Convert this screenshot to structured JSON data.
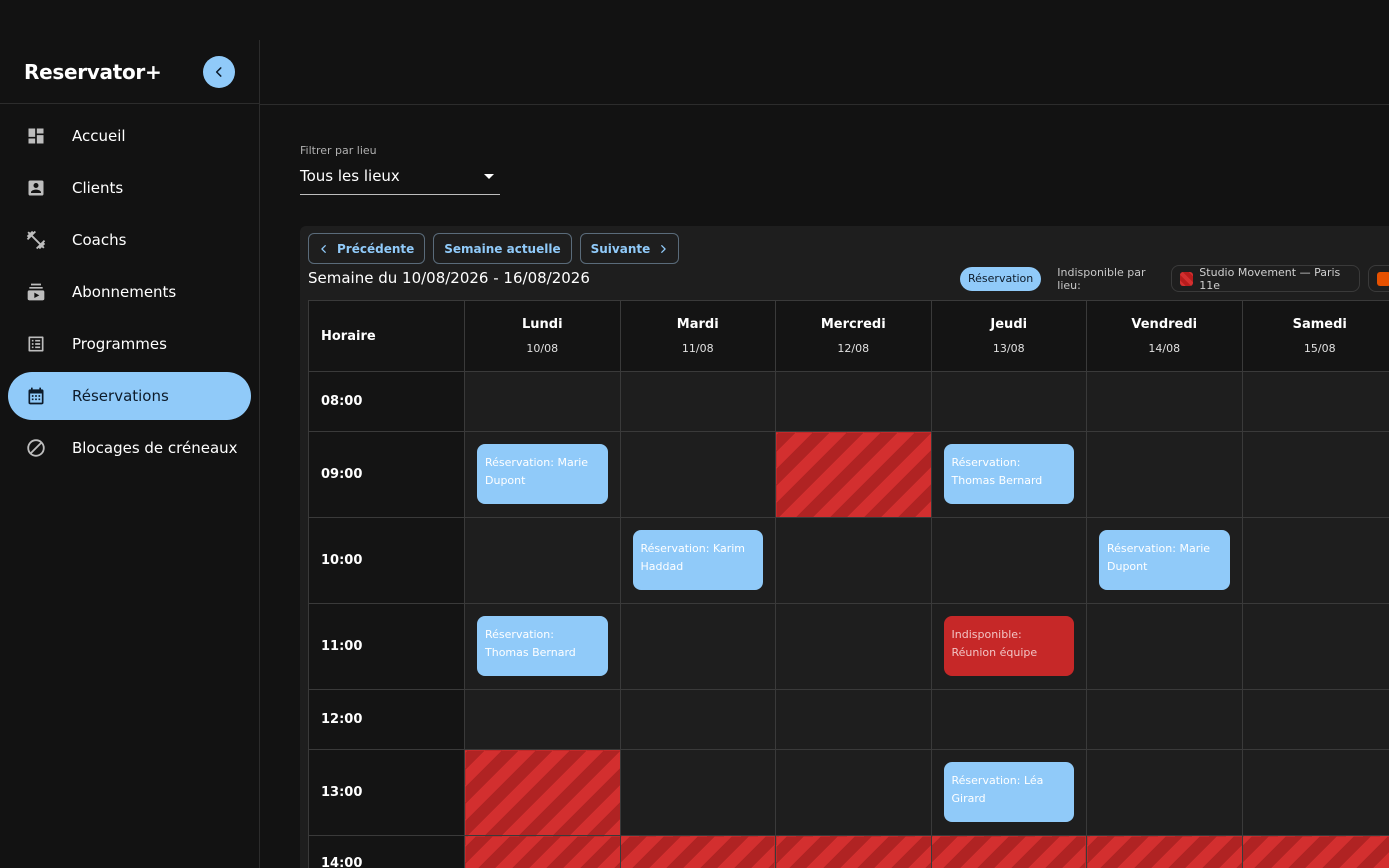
{
  "app": {
    "brand": "Reservator+"
  },
  "sidebar": {
    "items": [
      {
        "label": "Accueil",
        "icon": "dashboard-icon",
        "active": false
      },
      {
        "label": "Clients",
        "icon": "account-box-icon",
        "active": false
      },
      {
        "label": "Coachs",
        "icon": "dumbbell-icon",
        "active": false
      },
      {
        "label": "Abonnements",
        "icon": "subscriptions-icon",
        "active": false
      },
      {
        "label": "Programmes",
        "icon": "list-alt-icon",
        "active": false
      },
      {
        "label": "Réservations",
        "icon": "calendar-icon",
        "active": true
      },
      {
        "label": "Blocages de créneaux",
        "icon": "block-icon",
        "active": false
      }
    ]
  },
  "filter": {
    "label": "Filtrer par lieu",
    "value": "Tous les lieux"
  },
  "calendar": {
    "prev_label": "Précédente",
    "current_label": "Semaine actuelle",
    "next_label": "Suivante",
    "week_title": "Semaine du 10/08/2026 - 16/08/2026",
    "legend": {
      "reservation": "Réservation",
      "unavailable_label": "Indisponible par lieu:",
      "venue_1": "Studio Movement — Paris 11e"
    },
    "hour_header": "Horaire",
    "days": [
      {
        "name": "Lundi",
        "date": "10/08"
      },
      {
        "name": "Mardi",
        "date": "11/08"
      },
      {
        "name": "Mercredi",
        "date": "12/08"
      },
      {
        "name": "Jeudi",
        "date": "13/08"
      },
      {
        "name": "Vendredi",
        "date": "14/08"
      },
      {
        "name": "Samedi",
        "date": "15/08"
      }
    ],
    "hours": [
      "08:00",
      "09:00",
      "10:00",
      "11:00",
      "12:00",
      "13:00",
      "14:00"
    ],
    "events": {
      "mon_09": "Réservation: Marie Dupont",
      "thu_09": "Réservation: Thomas Bernard",
      "tue_10": "Réservation: Karim Haddad",
      "fri_10": "Réservation: Marie Dupont",
      "mon_11": "Réservation: Thomas Bernard",
      "thu_11": "Indisponible: Réunion équipe",
      "thu_13": "Réservation: Léa Girard"
    }
  },
  "colors": {
    "accent": "#90caf9",
    "unavailable": "#c62828",
    "blocked_stripe": "#d32f2f",
    "background": "#121212",
    "panel": "#1e1e1e"
  }
}
